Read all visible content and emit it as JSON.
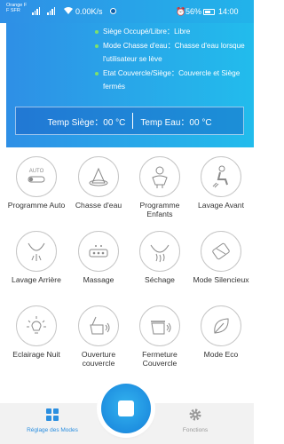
{
  "statusbar": {
    "carrier_line1": "Orange F",
    "carrier_line2": "F SFR",
    "speed": "0.00K/s",
    "battery": "56%",
    "time": "14:00"
  },
  "status": {
    "items": [
      "Siège Occupé/Libre：Libre",
      "Mode Chasse d'eau：Chasse d'eau lorsque l'utilisateur se lève",
      "Etat Couvercle/Siège：Couvercle et Siège fermés"
    ],
    "temp_seat": "Temp Siège：00 °C",
    "temp_water": "Temp Eau：00 °C"
  },
  "modes": [
    {
      "label": "Programme Auto",
      "icon": "auto-toggle-icon",
      "icon_text": "AUTO"
    },
    {
      "label": "Chasse d'eau",
      "icon": "water-cone-icon"
    },
    {
      "label": "Programme Enfants",
      "icon": "child-icon"
    },
    {
      "label": "Lavage Avant",
      "icon": "front-wash-icon"
    },
    {
      "label": "Lavage Arrière",
      "icon": "rear-wash-icon"
    },
    {
      "label": "Massage",
      "icon": "massage-icon"
    },
    {
      "label": "Séchage",
      "icon": "drying-icon"
    },
    {
      "label": "Mode Silencieux",
      "icon": "silent-mode-icon"
    },
    {
      "label": "Eclairage Nuit",
      "icon": "night-light-icon"
    },
    {
      "label": "Ouverture couvercle",
      "icon": "lid-open-icon"
    },
    {
      "label": "Fermeture Couvercle",
      "icon": "lid-close-icon"
    },
    {
      "label": "Mode Eco",
      "icon": "eco-leaf-icon"
    }
  ],
  "nav": {
    "modes_label": "Réglage des Modes",
    "functions_label": "Fonctions"
  },
  "colors": {
    "accent": "#2b8fe0",
    "status_dot": "#7fe06a",
    "icon_gray": "#8a8a8a"
  }
}
